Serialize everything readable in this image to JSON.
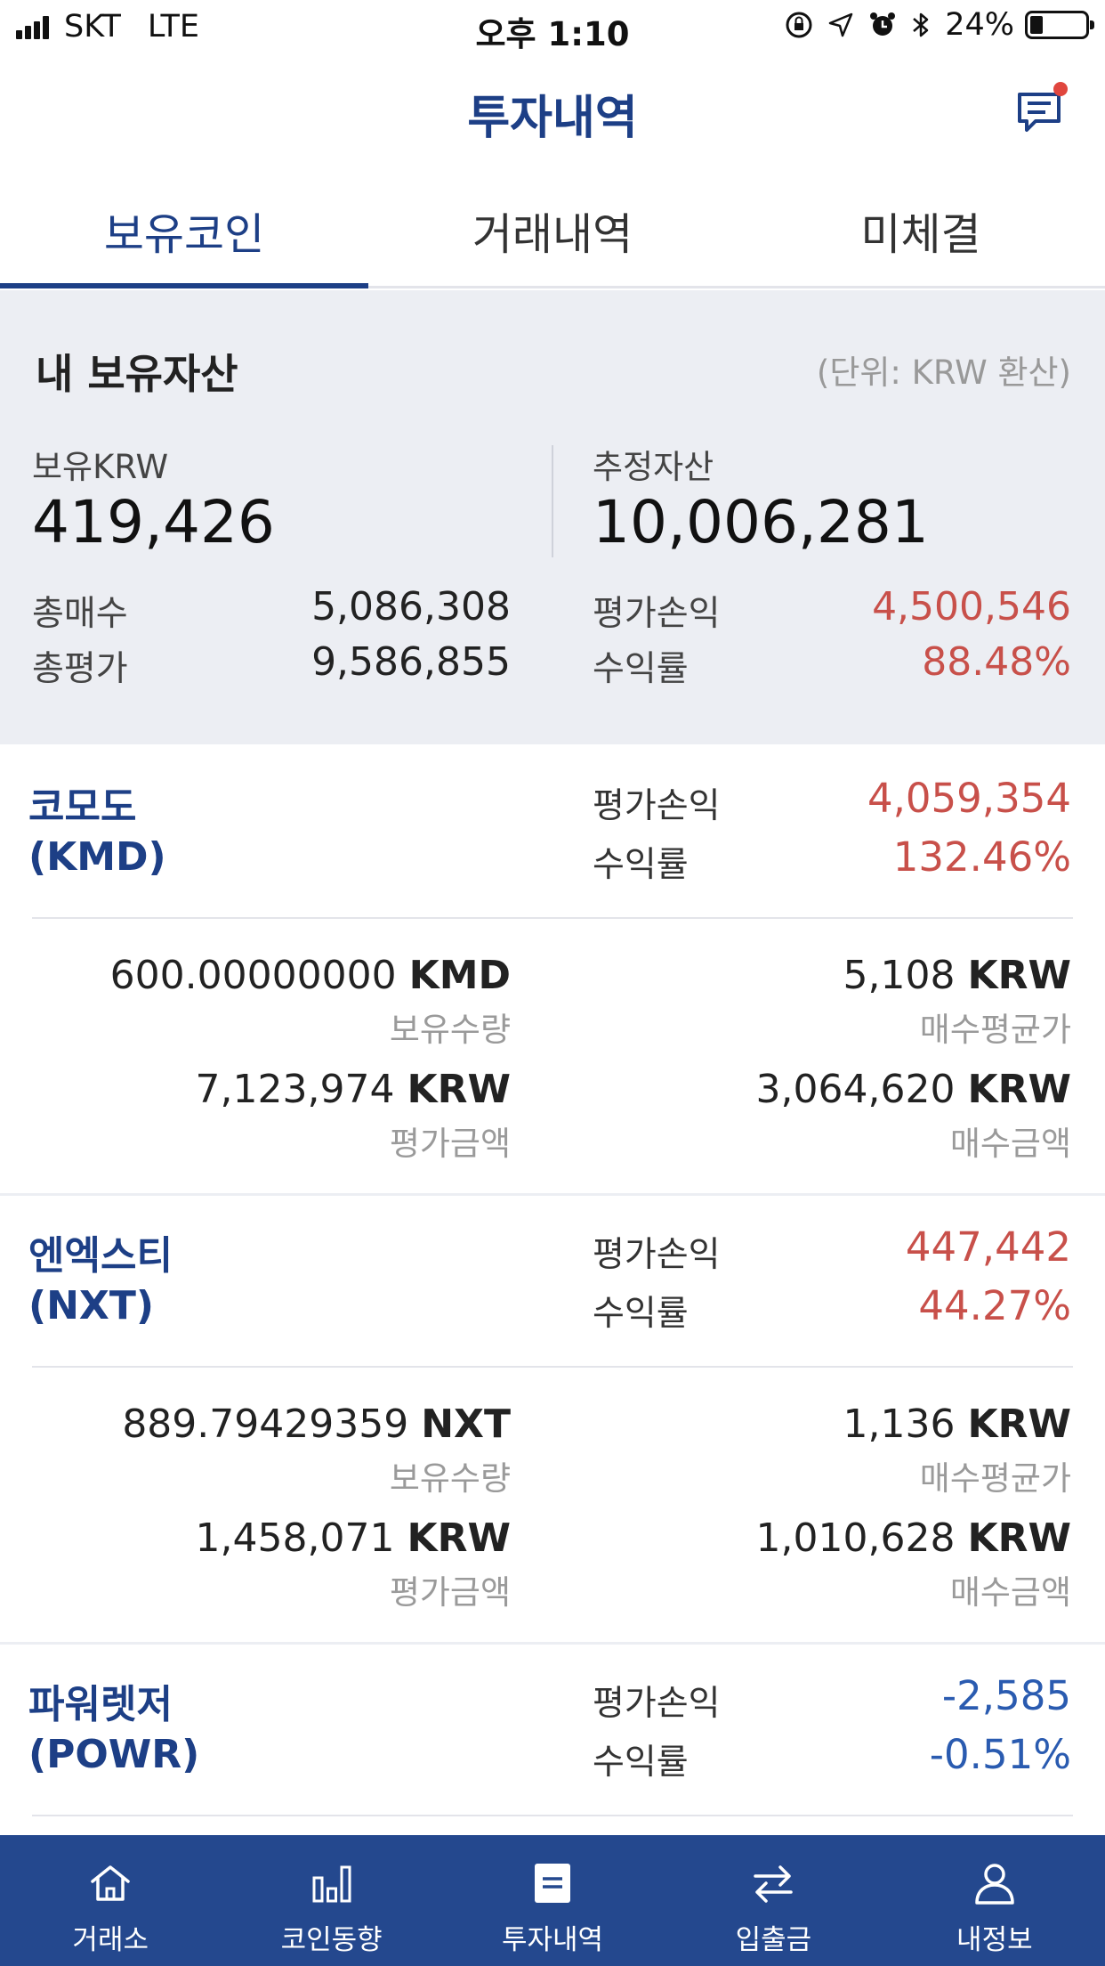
{
  "status": {
    "carrier": "SKT",
    "network": "LTE",
    "time": "오후 1:10",
    "battery": "24%",
    "battery_level": 0.24
  },
  "header": {
    "title": "투자내역"
  },
  "tabs": [
    {
      "label": "보유코인",
      "active": true
    },
    {
      "label": "거래내역",
      "active": false
    },
    {
      "label": "미체결",
      "active": false
    }
  ],
  "summary": {
    "title": "내 보유자산",
    "unit": "(단위: KRW 환산)",
    "krw_label": "보유KRW",
    "krw_value": "419,426",
    "est_label": "추정자산",
    "est_value": "10,006,281",
    "total_buy_label": "총매수",
    "total_buy_value": "5,086,308",
    "total_eval_label": "총평가",
    "total_eval_value": "9,586,855",
    "pnl_label": "평가손익",
    "pnl_value": "4,500,546",
    "rate_label": "수익률",
    "rate_value": "88.48%"
  },
  "coins": [
    {
      "name": "코모도",
      "symbol": "(KMD)",
      "pnl_label": "평가손익",
      "pnl": "4,059,354",
      "rate_label": "수익률",
      "rate": "132.46%",
      "qty": "600.00000000",
      "qty_unit": "KMD",
      "qty_label": "보유수량",
      "avg_price": "5,108",
      "avg_unit": "KRW",
      "avg_label": "매수평균가",
      "eval_amount": "7,123,974",
      "eval_unit": "KRW",
      "eval_label": "평가금액",
      "buy_amount": "3,064,620",
      "buy_unit": "KRW",
      "buy_label": "매수금액"
    },
    {
      "name": "엔엑스티",
      "symbol": "(NXT)",
      "pnl_label": "평가손익",
      "pnl": "447,442",
      "rate_label": "수익률",
      "rate": "44.27%",
      "qty": "889.79429359",
      "qty_unit": "NXT",
      "qty_label": "보유수량",
      "avg_price": "1,136",
      "avg_unit": "KRW",
      "avg_label": "매수평균가",
      "eval_amount": "1,458,071",
      "eval_unit": "KRW",
      "eval_label": "평가금액",
      "buy_amount": "1,010,628",
      "buy_unit": "KRW",
      "buy_label": "매수금액"
    },
    {
      "name": "파워렛저",
      "symbol": "(POWR)",
      "pnl_label": "평가손익",
      "pnl": "-2,585",
      "rate_label": "수익률",
      "rate": "-0.51%"
    }
  ],
  "nav": [
    {
      "label": "거래소",
      "icon": "home-icon"
    },
    {
      "label": "코인동향",
      "icon": "bar-chart-icon"
    },
    {
      "label": "투자내역",
      "icon": "document-icon"
    },
    {
      "label": "입출금",
      "icon": "transfer-icon"
    },
    {
      "label": "내정보",
      "icon": "user-icon"
    }
  ],
  "colors": {
    "brand": "#1d3f86",
    "nav_bg": "#24488e",
    "profit": "#c8504a",
    "loss": "#2a5bb0",
    "summary_bg": "#eceef3"
  }
}
